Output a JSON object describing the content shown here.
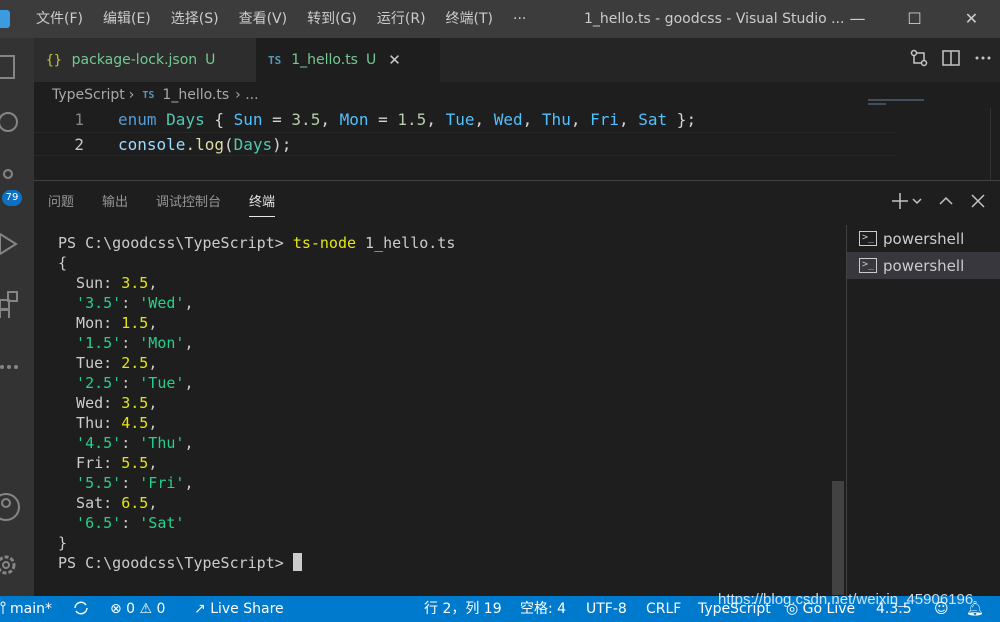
{
  "titlebar": {
    "menu": [
      "文件(F)",
      "编辑(E)",
      "选择(S)",
      "查看(V)",
      "转到(G)",
      "运行(R)",
      "终端(T)",
      "···"
    ],
    "title": "1_hello.ts - goodcss - Visual Studio ...",
    "minimize": "—",
    "maximize": "☐",
    "close": "✕"
  },
  "activity": {
    "badge": "79"
  },
  "tabs": [
    {
      "icon": "{}",
      "label": "package-lock.json",
      "status": "U"
    },
    {
      "icon": "TS",
      "label": "1_hello.ts",
      "status": "U",
      "close": "✕"
    }
  ],
  "breadcrumb": {
    "folder": "TypeScript",
    "sep": "›",
    "icon": "TS",
    "file": "1_hello.ts",
    "more": "› ..."
  },
  "editor": {
    "line1_num": "1",
    "line2_num": "2",
    "line1": {
      "kw": "enum",
      "name": "Days",
      "open": " { ",
      "sun": "Sun",
      "eq1": " = ",
      "v1": "3.5",
      "c1": ", ",
      "mon": "Mon",
      "eq2": " = ",
      "v2": "1.5",
      "rest_c": ", ",
      "tue": "Tue",
      "c2": ", ",
      "wed": "Wed",
      "c3": ", ",
      "thu": "Thu",
      "c4": ", ",
      "fri": "Fri",
      "c5": ", ",
      "sat": "Sat",
      "close": " };"
    },
    "line2": {
      "obj": "console",
      "dot": ".",
      "fn": "log",
      "p1": "(",
      "arg": "Days",
      "p2": ");"
    }
  },
  "panel": {
    "tabs": [
      "问题",
      "输出",
      "调试控制台",
      "终端"
    ],
    "terminals": [
      "powershell",
      "powershell"
    ]
  },
  "terminal": {
    "prompt": "PS C:\\goodcss\\TypeScript> ",
    "cmd1": "ts-node",
    "cmd2": " 1_hello.ts",
    "open": "{",
    "close": "}",
    "entries": [
      {
        "k": "  Sun: ",
        "v": "3.5",
        "t": ",",
        "type": "num"
      },
      {
        "k": "  '3.5'",
        "v": "'Wed'",
        "t": ",",
        "type": "str"
      },
      {
        "k": "  Mon: ",
        "v": "1.5",
        "t": ",",
        "type": "num"
      },
      {
        "k": "  '1.5'",
        "v": "'Mon'",
        "t": ",",
        "type": "str"
      },
      {
        "k": "  Tue: ",
        "v": "2.5",
        "t": ",",
        "type": "num"
      },
      {
        "k": "  '2.5'",
        "v": "'Tue'",
        "t": ",",
        "type": "str"
      },
      {
        "k": "  Wed: ",
        "v": "3.5",
        "t": ",",
        "type": "num"
      },
      {
        "k": "  Thu: ",
        "v": "4.5",
        "t": ",",
        "type": "num"
      },
      {
        "k": "  '4.5'",
        "v": "'Thu'",
        "t": ",",
        "type": "str"
      },
      {
        "k": "  Fri: ",
        "v": "5.5",
        "t": ",",
        "type": "num"
      },
      {
        "k": "  '5.5'",
        "v": "'Fri'",
        "t": ",",
        "type": "str"
      },
      {
        "k": "  Sat: ",
        "v": "6.5",
        "t": ",",
        "type": "num"
      },
      {
        "k": "  '6.5'",
        "v": "'Sat'",
        "t": "",
        "type": "str"
      }
    ],
    "final_prompt": "PS C:\\goodcss\\TypeScript> "
  },
  "status": {
    "branch": "main*",
    "errors": "⊗ 0 ⚠ 0",
    "liveshare": "Live Share",
    "position": "行 2，列 19",
    "spaces": "空格: 4",
    "encoding": "UTF-8",
    "eol": "CRLF",
    "language": "TypeScript",
    "golive": "Go Live",
    "version": "4.3.5"
  },
  "watermark": "https://blog.csdn.net/weixin_45906196"
}
